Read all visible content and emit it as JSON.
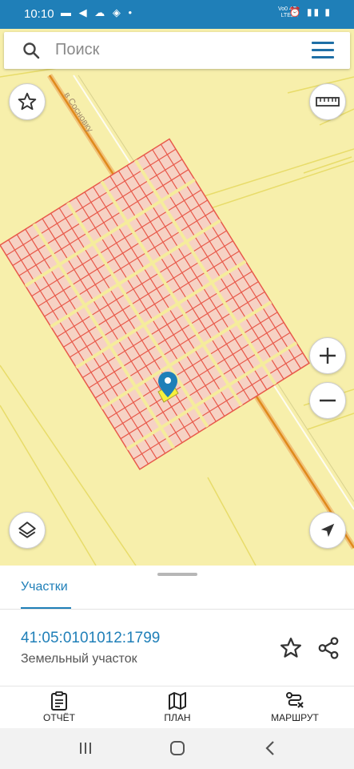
{
  "status": {
    "time": "10:10",
    "left_icons": "▬ ◀ ☁ ◈ •",
    "net_top": "Vo0 4G",
    "net_bottom": "LTE2",
    "right_icons": "⏰ ▮▮ ▮"
  },
  "search": {
    "placeholder": "Поиск"
  },
  "map": {
    "street_label": "в Сосновку"
  },
  "sheet": {
    "tab_label": "Участки",
    "parcel_id": "41:05:0101012:1799",
    "parcel_type": "Земельный участок"
  },
  "bottom_nav": [
    {
      "label": "ОТЧЁТ"
    },
    {
      "label": "ПЛАН"
    },
    {
      "label": "МАРШРУТ"
    }
  ],
  "colors": {
    "accent": "#1f7fb8",
    "map_bg": "#f7efab",
    "parcel_fill": "#f6d2c4",
    "parcel_line": "#e8594a",
    "road": "#e08a1c"
  }
}
